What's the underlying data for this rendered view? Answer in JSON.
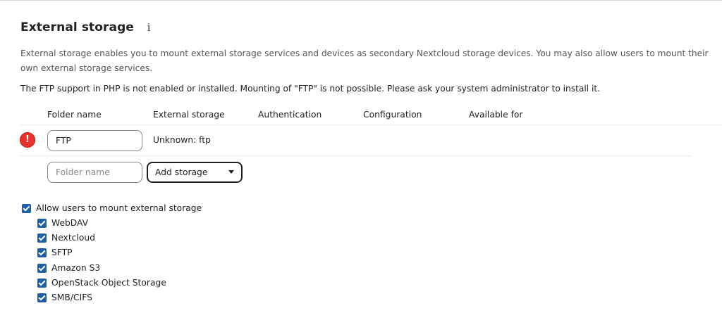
{
  "section": {
    "title": "External storage",
    "info_icon": "i",
    "description": "External storage enables you to mount external storage services and devices as secondary Nextcloud storage devices. You may also allow users to mount their own external storage services.",
    "warning": "The FTP support in PHP is not enabled or installed. Mounting of \"FTP\" is not possible. Please ask your system administrator to install it."
  },
  "table": {
    "columns": [
      "Folder name",
      "External storage",
      "Authentication",
      "Configuration",
      "Available for"
    ],
    "mounts": [
      {
        "folder_name": "FTP",
        "storage": "Unknown: ftp",
        "status_icon": "error-icon",
        "status_glyph": "!"
      }
    ],
    "new_mount": {
      "folder_placeholder": "Folder name",
      "storage_select": "Add storage"
    }
  },
  "user_mounting": {
    "allow_label": "Allow users to mount external storage",
    "allow_checked": true,
    "backends": [
      {
        "label": "WebDAV",
        "checked": true
      },
      {
        "label": "Nextcloud",
        "checked": true
      },
      {
        "label": "SFTP",
        "checked": true
      },
      {
        "label": "Amazon S3",
        "checked": true
      },
      {
        "label": "OpenStack Object Storage",
        "checked": true
      },
      {
        "label": "SMB/CIFS",
        "checked": true
      }
    ]
  },
  "colors": {
    "checkbox": "#1f5fa8",
    "error": "#e9322d"
  }
}
